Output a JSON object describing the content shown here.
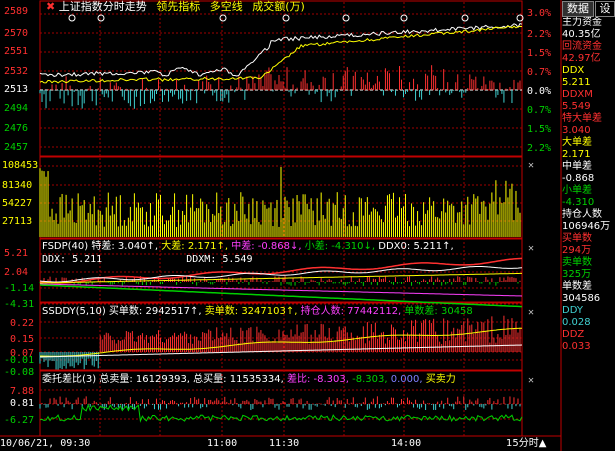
{
  "colors": {
    "red": "#ff3030",
    "green": "#00d000",
    "yellow": "#ffff00",
    "white": "#ffffff",
    "cyan": "#40d0d0",
    "magenta": "#ff40ff",
    "grid": "#a00000",
    "axis": "#c00000"
  },
  "tabs": [
    {
      "label": "数据"
    },
    {
      "label": "设"
    }
  ],
  "panel_main": {
    "title": "上证指数分时走势",
    "legend": [
      "领先指标",
      "多空线",
      "成交额(万)"
    ],
    "y_left": [
      "2589",
      "2570",
      "2551",
      "2532",
      "2513",
      "2494",
      "2476",
      "2457"
    ],
    "y_right": [
      "3.0%",
      "2.2%",
      "1.5%",
      "0.7%",
      "0.0%",
      "0.7%",
      "1.5%",
      "2.2%"
    ]
  },
  "panel_volume": {
    "y_left": [
      "108453",
      "81340",
      "54227",
      "27113"
    ]
  },
  "panel_fsdp": {
    "items": [
      {
        "text": "FSDP(40)"
      },
      {
        "text": "特差: 3.040↑,"
      },
      {
        "text": "大差: 2.171↑,"
      },
      {
        "text": "中差: -0.868↓,"
      },
      {
        "text": "小差: -4.310↓,"
      },
      {
        "text": "DDX0: 5.211↑,"
      }
    ],
    "line2": [
      {
        "text": "DDX: 5.211"
      },
      {
        "text": "DDXM: 5.549"
      }
    ],
    "y_left": [
      "5.21",
      "2.04",
      "-1.14",
      "-4.31"
    ]
  },
  "panel_ssddy": {
    "items": [
      {
        "text": "SSDDY(5,10)"
      },
      {
        "text": "买单数: 2942517↑,"
      },
      {
        "text": "卖单数: 3247103↑,"
      },
      {
        "text": "持仓人数: 77442112,"
      },
      {
        "text": "单数差: 30458"
      }
    ],
    "y_left": [
      "0.22",
      "0.15",
      "0.07",
      "-0.01",
      "-0.08"
    ]
  },
  "panel_weituo": {
    "items": [
      {
        "text": "委托差比(3)"
      },
      {
        "text": "总卖量: 16129393,"
      },
      {
        "text": "总买量: 11535334,"
      },
      {
        "text": "差比: -8.303,"
      },
      {
        "text": "-8.303,"
      },
      {
        "text": "0.000,"
      },
      {
        "text": "买卖力"
      }
    ],
    "y_left": [
      "7.88",
      "0.81",
      "-6.27"
    ]
  },
  "time_axis": {
    "labels": [
      "10/06/21, 09:30",
      "11:00",
      "11:30",
      "14:00"
    ],
    "period_button": "15分时▲"
  },
  "sidebar": {
    "items": [
      {
        "label": "主力资金",
        "value": "40.35亿"
      },
      {
        "label": "回流资金",
        "value": "42.97亿"
      },
      {
        "label": "DDX",
        "value": "5.211"
      },
      {
        "label": "DDXM",
        "value": "5.549"
      },
      {
        "label": "特大单差",
        "value": "3.040"
      },
      {
        "label": "大单差",
        "value": "2.171"
      },
      {
        "label": "中单差",
        "value": "-0.868"
      },
      {
        "label": "小单差",
        "value": "-4.310"
      },
      {
        "label": "持仓人数",
        "value": "106946万"
      },
      {
        "label": "买单数",
        "value": "294万"
      },
      {
        "label": "卖单数",
        "value": "325万"
      },
      {
        "label": "单数差",
        "value": "304586"
      },
      {
        "label": "DDY",
        "value": "0.028"
      },
      {
        "label": "DDZ",
        "value": "0.033"
      }
    ]
  }
}
